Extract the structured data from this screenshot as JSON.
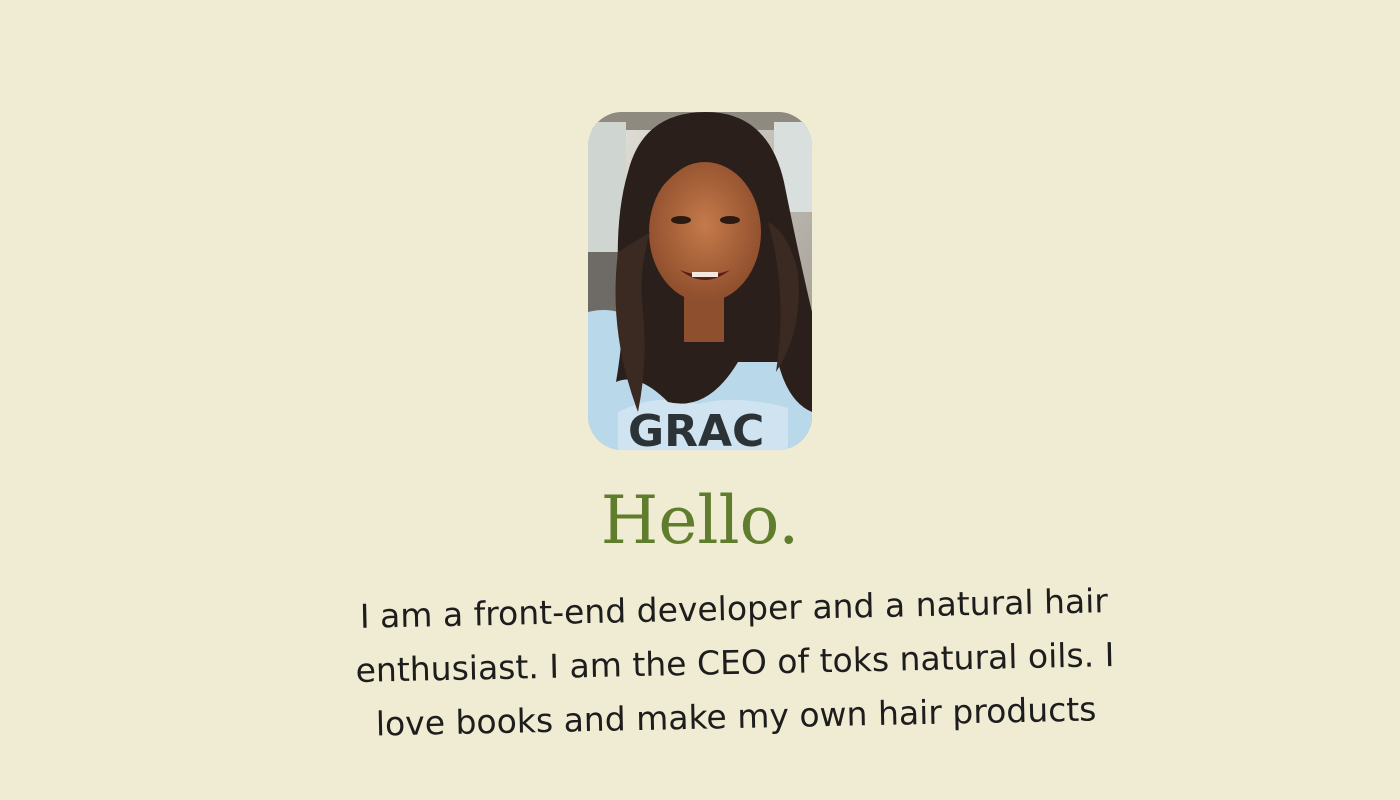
{
  "profile": {
    "photo_alt": "portrait-photo",
    "greeting": "Hello.",
    "bio": "I am a front-end developer and a natural hair enthusiast. I am the CEO of toks natural oils. I love books and make my own hair products",
    "shirt_text": "GRAC"
  },
  "colors": {
    "background": "#f0ebd3",
    "greeting": "#5f7d2c",
    "bio_text": "#1d1d1d"
  }
}
